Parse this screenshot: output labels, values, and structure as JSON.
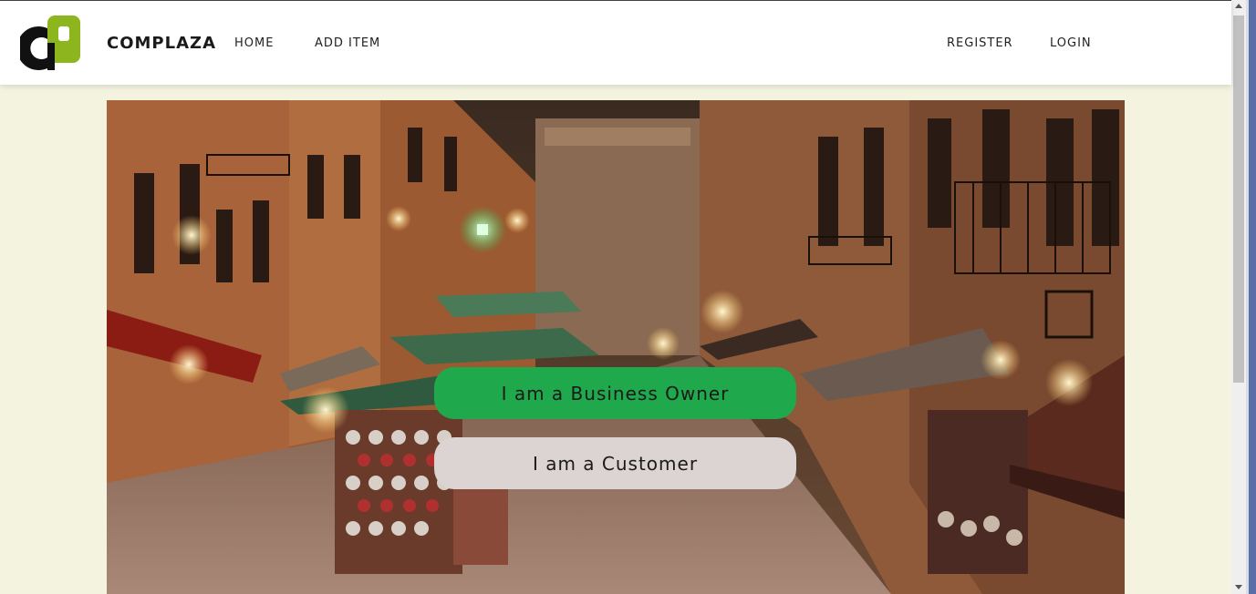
{
  "header": {
    "brand": "COMPLAZA",
    "nav_left": [
      "HOME",
      "ADD ITEM"
    ],
    "nav_right": [
      "REGISTER",
      "LOGIN"
    ]
  },
  "hero": {
    "business_owner_label": "I am a Business Owner",
    "customer_label": "I am a Customer"
  },
  "colors": {
    "page_background": "#f3f3df",
    "logo_green": "#8cb51e",
    "business_button": "#20a84c",
    "customer_button": "#dcd3d3"
  }
}
